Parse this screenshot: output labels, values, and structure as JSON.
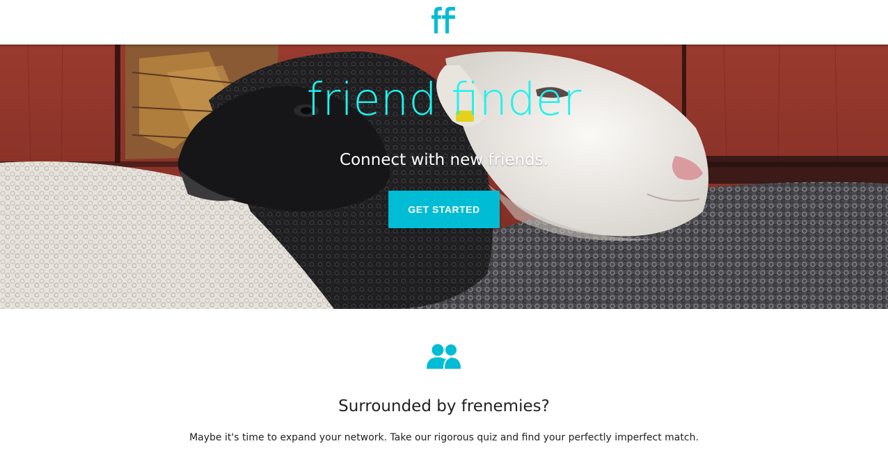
{
  "navbar": {
    "logo_icon": "friend-finder-logo-icon",
    "logo_color": "#00bcd4"
  },
  "hero": {
    "title": "friend finder",
    "subtitle": "Connect with new friends.",
    "cta_label": "GET STARTED",
    "title_color": "#1ef2ee",
    "cta_color": "#00bcd4",
    "background_image": "sheep-photo"
  },
  "feature": {
    "icon": "people-icon",
    "icon_color": "#00bcd4",
    "heading": "Surrounded by frenemies?",
    "text": "Maybe it's time to expand your network. Take our rigorous quiz and find your perfectly imperfect match."
  }
}
